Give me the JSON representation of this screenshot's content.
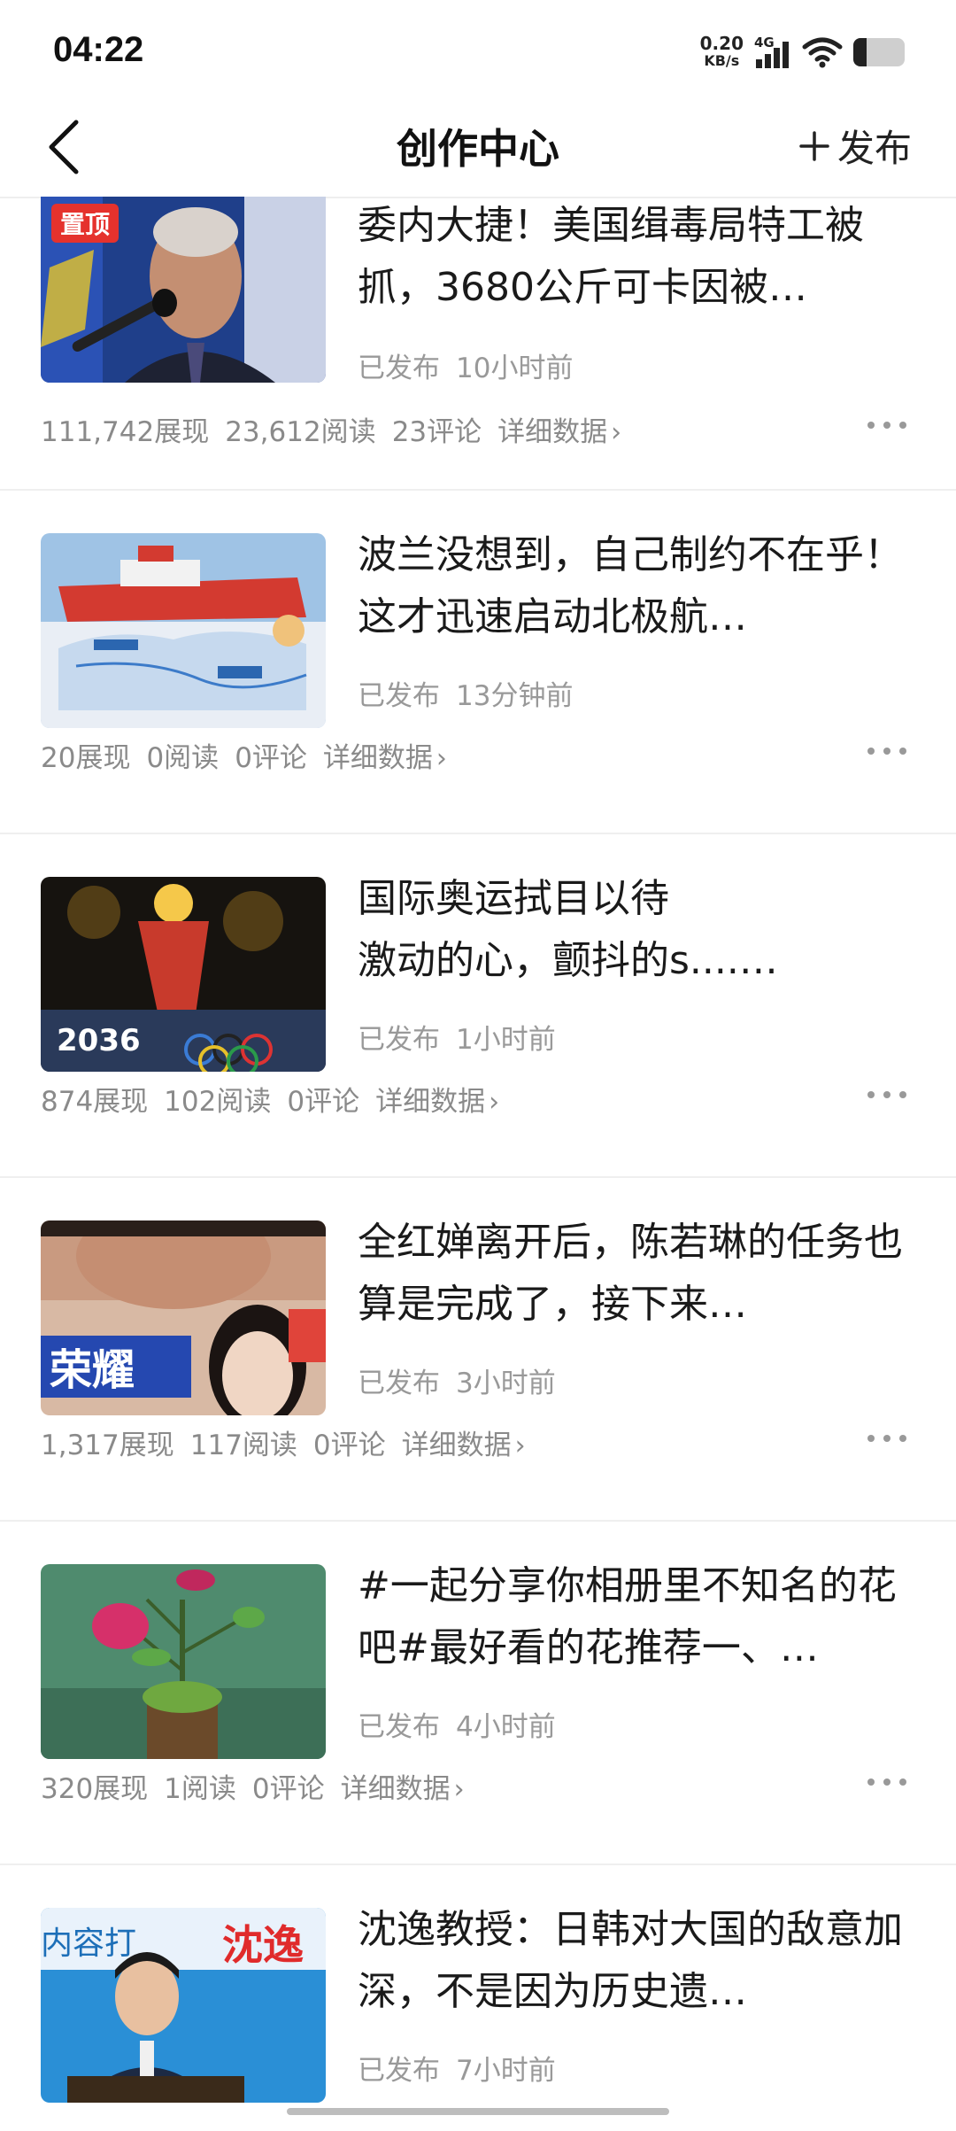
{
  "status_bar": {
    "time": "04:22",
    "net_speed_value": "0.20",
    "net_speed_unit": "KB/s",
    "network": "4G",
    "battery_level": 0.25
  },
  "nav": {
    "title": "创作中心",
    "publish_label": "发布",
    "back_icon": "chevron-left-icon"
  },
  "items": [
    {
      "badge": "置顶",
      "title": "委内大捷！美国缉毒局特工被抓，3680公斤可卡因被…",
      "status": "已发布",
      "time": "10小时前",
      "views": "111,742展现",
      "reads": "23,612阅读",
      "comments": "23评论",
      "detail": "详细数据"
    },
    {
      "title": "波兰没想到，自己制约不在乎！这才迅速启动北极航…",
      "status": "已发布",
      "time": "13分钟前",
      "views": "20展现",
      "reads": "0阅读",
      "comments": "0评论",
      "detail": "详细数据"
    },
    {
      "title": "国际奥运拭目以待\n激动的心，颤抖的s....…",
      "status": "已发布",
      "time": "1小时前",
      "views": "874展现",
      "reads": "102阅读",
      "comments": "0评论",
      "detail": "详细数据",
      "thumb_text": "2036"
    },
    {
      "title": "全红婵离开后，陈若琳的任务也算是完成了，接下来…",
      "status": "已发布",
      "time": "3小时前",
      "views": "1,317展现",
      "reads": "117阅读",
      "comments": "0评论",
      "detail": "详细数据",
      "thumb_text": "荣耀"
    },
    {
      "title": "#一起分享你相册里不知名的花吧#最好看的花推荐一、…",
      "status": "已发布",
      "time": "4小时前",
      "views": "320展现",
      "reads": "1阅读",
      "comments": "0评论",
      "detail": "详细数据"
    },
    {
      "title": "沈逸教授：日韩对大国的敌意加深，不是因为历史遗…",
      "status": "已发布",
      "time": "7小时前",
      "thumb_text": "沈逸",
      "thumb_text2": "内容打"
    }
  ]
}
